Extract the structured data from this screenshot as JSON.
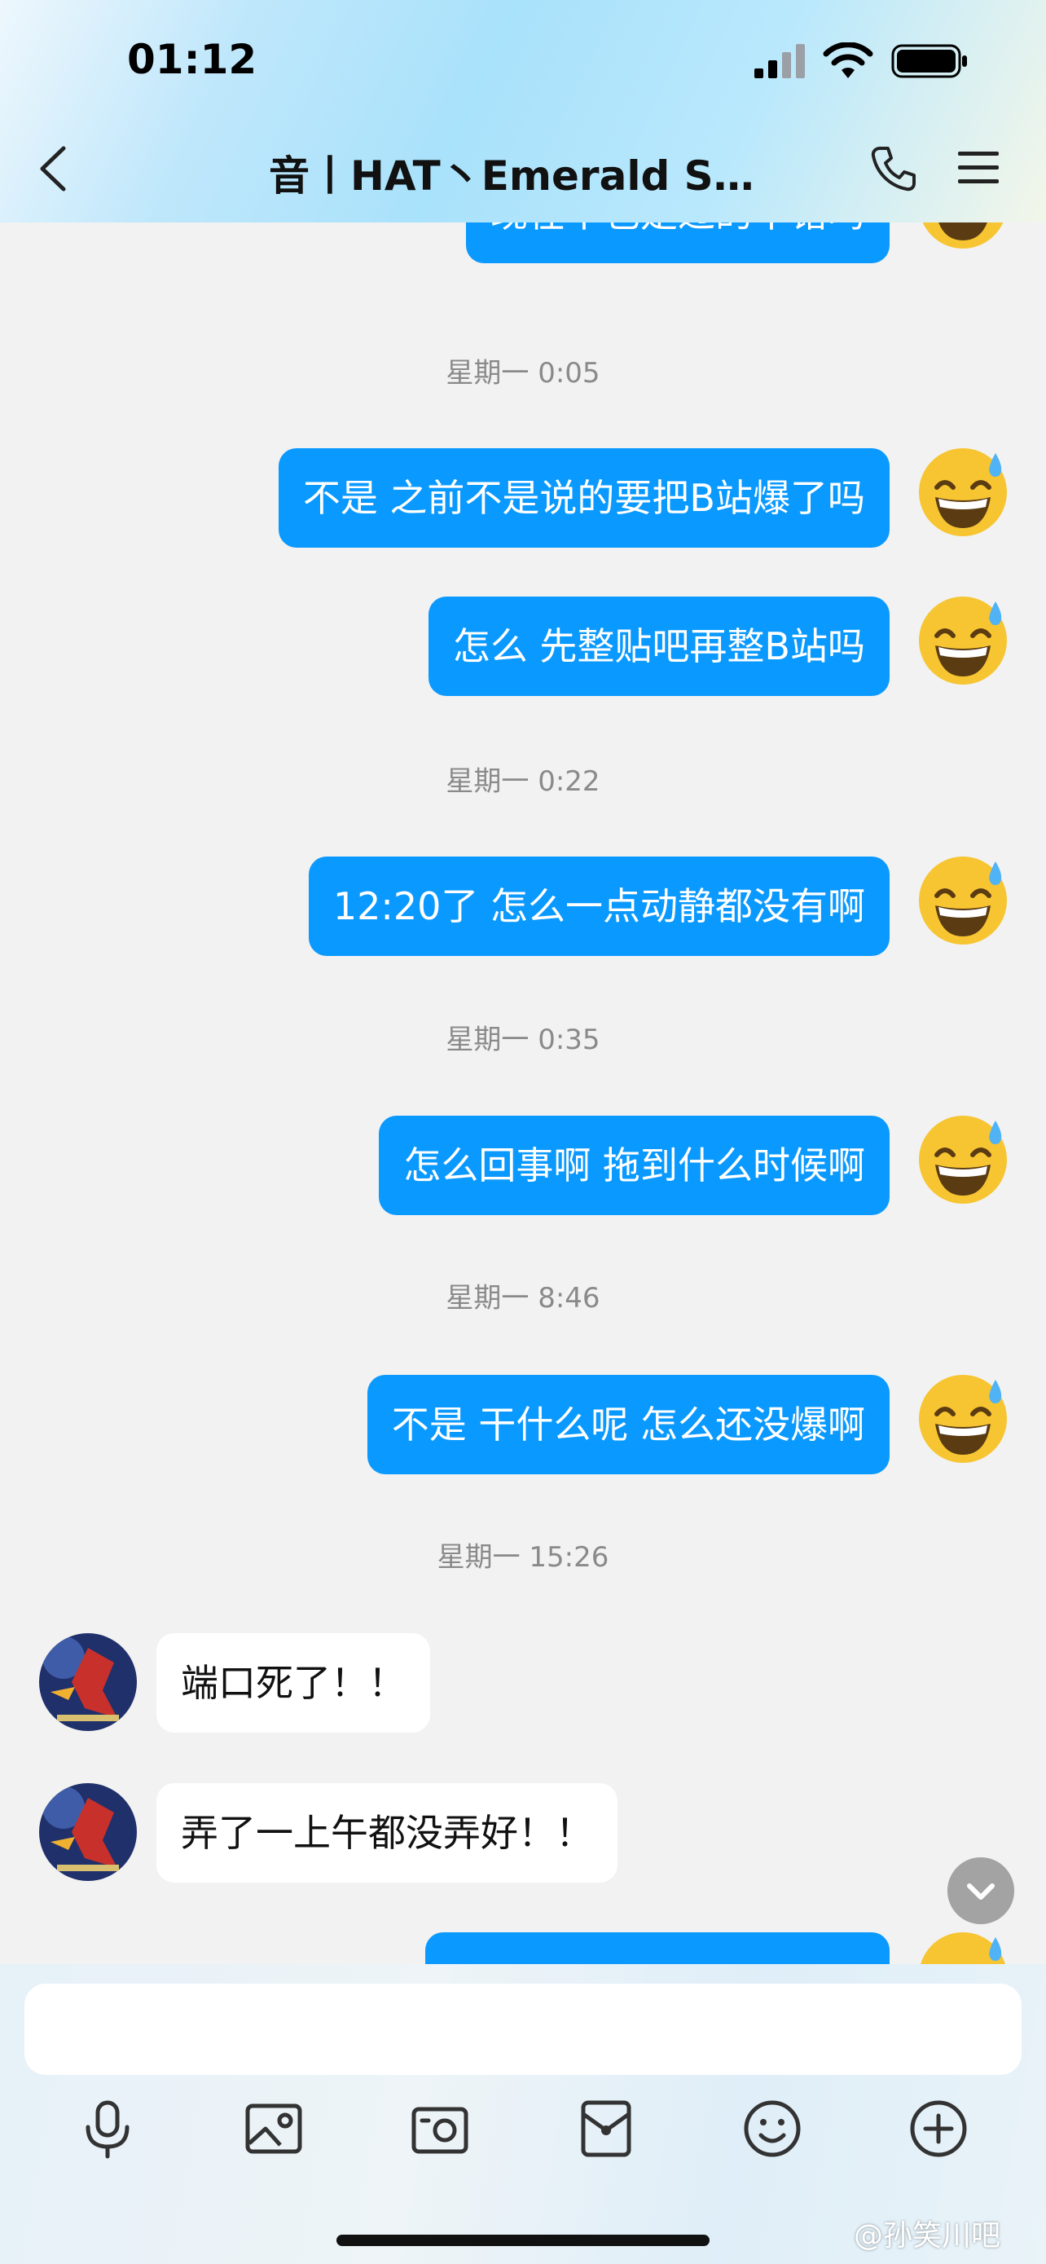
{
  "status_bar": {
    "time": "01:12"
  },
  "header": {
    "title": "音丨HAT丶Emerald S…"
  },
  "messages": [
    {
      "type": "out",
      "text": "现在不也是过的不错吗"
    },
    {
      "type": "time",
      "text": "星期一 0:05"
    },
    {
      "type": "out",
      "text": "不是 之前不是说的要把B站爆了吗"
    },
    {
      "type": "out",
      "text": "怎么 先整贴吧再整B站吗"
    },
    {
      "type": "time",
      "text": "星期一 0:22"
    },
    {
      "type": "out",
      "text": "12:20了 怎么一点动静都没有啊"
    },
    {
      "type": "time",
      "text": "星期一 0:35"
    },
    {
      "type": "out",
      "text": "怎么回事啊 拖到什么时候啊"
    },
    {
      "type": "time",
      "text": "星期一 8:46"
    },
    {
      "type": "out",
      "text": "不是 干什么呢 怎么还没爆啊"
    },
    {
      "type": "time",
      "text": "星期一 15:26"
    },
    {
      "type": "in",
      "text": "端口死了！！"
    },
    {
      "type": "in",
      "text": "弄了一上午都没弄好！！"
    }
  ],
  "input": {
    "placeholder": ""
  },
  "toolbar": [
    "microphone-icon",
    "photo-icon",
    "camera-icon",
    "red-packet-icon",
    "emoji-icon",
    "plus-icon"
  ],
  "watermark": "@孙笑川吧",
  "colors": {
    "outgoing_bubble": "#0a99ff",
    "incoming_bubble": "#ffffff",
    "background": "#f2f2f2"
  }
}
